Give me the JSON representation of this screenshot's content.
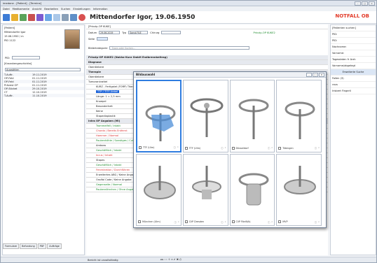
{
  "window": {
    "title": "imedone - [Patient] - [Termine]",
    "controls": [
      "–",
      "□",
      "×"
    ]
  },
  "menu": [
    "Datei",
    "Medikamente",
    "Ansicht",
    "Bearbeiten",
    "Suchen",
    "Einstellungen",
    "Information"
  ],
  "header": {
    "patient_name": "Mittendorfer Igor, 19.06.1950",
    "notfall": "NOTFALL OB"
  },
  "left_panel": {
    "title": "[Patient]",
    "lines": [
      "Mittendorfer Igor",
      "19.06.1950 / m",
      "PID 1122"
    ],
    "pid_label": "PID:",
    "search_label": "[Kraankengeschichte]",
    "search_placeholder": "Auswählen",
    "rows": [
      {
        "name": "T-Auftr.",
        "date": "19.11.2019"
      },
      {
        "name": "OP-Feld",
        "date": "01.11.2019"
      },
      {
        "name": "OP-Feld",
        "date": "01.11.2019"
      },
      {
        "name": "Prävest OP",
        "date": "01.11.2019"
      },
      {
        "name": "OP-Sticket",
        "date": "29.10.2019"
      },
      {
        "name": "CT",
        "date": "12.10.2019"
      },
      {
        "name": "T-Auftr.",
        "date": "11.10.2019"
      }
    ],
    "tabs": [
      "Formulare",
      "Befundung",
      "PDF",
      "Aufträge"
    ]
  },
  "form": {
    "title": "[Prinzip-OP KUKE]",
    "datum_label": "Datum",
    "datum_value": "29.06.2019",
    "typ_label": "Typ",
    "typ_value": "Sonst.FILE",
    "chirurg_label": "Chirurg",
    "seite_label": "Seite",
    "kit_label": "Prinzip-OP KUKE2",
    "search_placeholder": "Typen oder Suchen...",
    "bilderkategorie": "Bilderkategorie",
    "section_title": "Prinzip-OP KUKE2 (Nakha-Kurz GmbH Endbrennbeitrag)",
    "sections": [
      {
        "label": "Diagnose",
        "type": "h"
      },
      {
        "label": "Oberdiebere",
        "type": "n"
      },
      {
        "label": "Therapie",
        "type": "h"
      },
      {
        "label": "Oberdiebere",
        "type": "n"
      },
      {
        "label": "Tumorankrattel",
        "type": "n"
      },
      {
        "label": "KURZ - Fertigstel (FORP) Titan",
        "type": "n"
      },
      {
        "label": "TTP / TITF-Uebel",
        "type": "hl"
      },
      {
        "label": "Länge: 1 = 2,5 mm",
        "type": "n"
      },
      {
        "label": "Knoepel",
        "type": "n"
      },
      {
        "label": "Besonderheit",
        "type": "n"
      },
      {
        "label": "Keine",
        "type": "n"
      },
      {
        "label": "Stapediaplastik",
        "type": "n"
      },
      {
        "label": "Intra OP Angaben (MI)",
        "type": "h"
      },
      {
        "label": "Trommelfell / Intakt",
        "type": "g"
      },
      {
        "label": "Chorda / Bereits Entfernt",
        "type": "r"
      },
      {
        "label": "Hammer / Normal",
        "type": "r"
      },
      {
        "label": "Paukenhöhle / Sonstiges / Cut",
        "type": "g"
      },
      {
        "label": "Amboss",
        "type": "n"
      },
      {
        "label": "Geschäftlich / Intakt",
        "type": "g"
      },
      {
        "label": "Incus / Intakt",
        "type": "r"
      },
      {
        "label": "Stapes",
        "type": "n"
      },
      {
        "label": "Geschäftlich / Intakt",
        "type": "g"
      },
      {
        "label": "Fenestration / Durchführen",
        "type": "r"
      },
      {
        "label": "Erweitertes ABG / Keine Angabe",
        "type": "n"
      },
      {
        "label": "Ossifal Code / Keine Angabe",
        "type": "n"
      },
      {
        "label": "Gegenseite / Normal",
        "type": "g"
      },
      {
        "label": "Paukenröhrchen / Ohne Angabe",
        "type": "g"
      }
    ],
    "footer_checkbox": "Bericht ist unvollständig"
  },
  "right_panel": {
    "title": "[Patienten suchen]",
    "fields": [
      "PID:",
      "PID:",
      "Nachname:",
      "Vorname:",
      "Tagesdaten fr Arzt:",
      "Vorname/abgelegt"
    ],
    "button": "Erweiterte Suche",
    "rows": [
      "Fallen (3)",
      "raus",
      "Irisbert Fingerli"
    ]
  },
  "dialog": {
    "title": "Bildauswahl",
    "items": [
      {
        "caption": "TTF (Ulm)",
        "selected": true
      },
      {
        "caption": "TTF (Ulm)",
        "selected": false
      },
      {
        "caption": "Düsseldorf",
        "selected": false
      },
      {
        "caption": "Tübingen",
        "selected": false
      },
      {
        "caption": "München (Ulm)",
        "selected": false
      },
      {
        "caption": "CliP Dresden",
        "selected": false
      },
      {
        "caption": "CliP FibriNAL",
        "selected": false
      },
      {
        "caption": "MVP",
        "selected": false
      }
    ]
  },
  "colors": {
    "accent": "#1c63d8",
    "notfall": "#e23b2a",
    "green": "#1a8a2a",
    "red": "#d33"
  }
}
